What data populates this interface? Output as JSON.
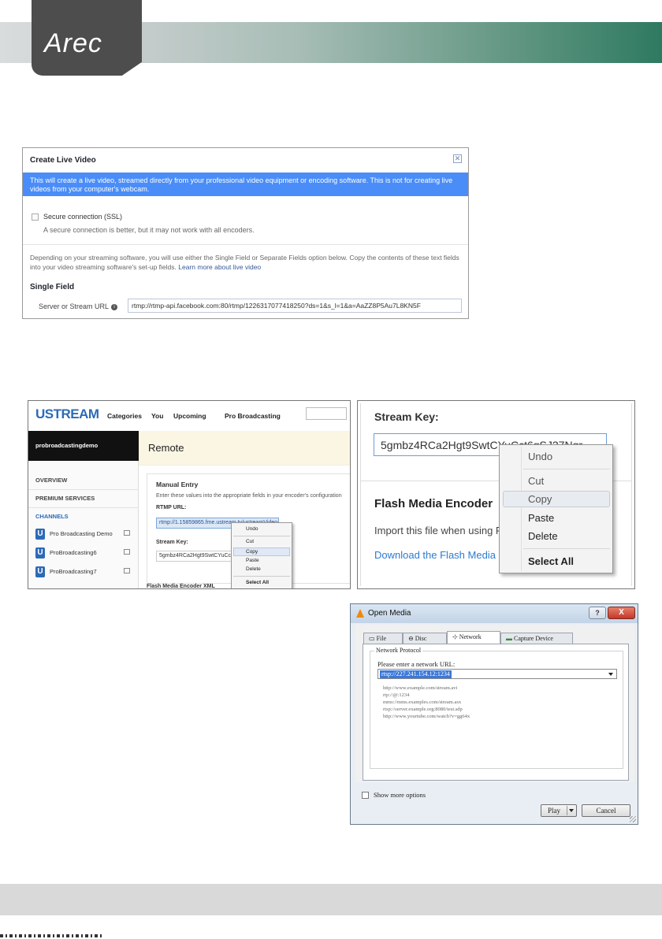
{
  "brand": {
    "logo_text": "Arec"
  },
  "facebook_dialog": {
    "title": "Create Live Video",
    "close_glyph": "✕",
    "banner": "This will create a live video, streamed directly from your professional video equipment or encoding software. This is not for creating live videos from your computer's webcam.",
    "ssl_label": "Secure connection (SSL)",
    "ssl_note": "A secure connection is better, but it may not work with all encoders.",
    "description": "Depending on your streaming software, you will use either the Single Field or Separate Fields option below. Copy the contents of these text fields into your video streaming software's set-up fields.",
    "learn_more": "Learn more about live video",
    "single_field_heading": "Single Field",
    "url_label": "Server or Stream URL",
    "info_glyph": "i",
    "url_value": "rtmp://rtmp-api.facebook.com:80/rtmp/1226317077418250?ds=1&s_l=1&a=AaZZ8P5Au7L8KN5F"
  },
  "ustream": {
    "logo": "USTREAM",
    "nav": [
      "Categories",
      "You",
      "Upcoming",
      "Pro Broadcasting"
    ],
    "username": "probroadcastingdemo",
    "menu": {
      "overview": "OVERVIEW",
      "premium": "PREMIUM SERVICES",
      "channels": "CHANNELS"
    },
    "channels": [
      "Pro Broadcasting Demo",
      "ProBroadcasting6",
      "ProBroadcasting7"
    ],
    "channel_glyph": "U",
    "page_title": "Remote",
    "manual_entry": "Manual Entry",
    "manual_hint": "Enter these values into the appropriate fields in your encoder's configuration",
    "rtmp_label": "RTMP URL:",
    "rtmp_value": "rtmp://1.15859865.fme.ustream.tv/ustreamVideo/15859865",
    "stream_key_label": "Stream Key:",
    "stream_key_value": "5gmbz4RCa2Hgt9SwtCYuCct6gSJ27Ngr",
    "bottom_text": "Flash Media Encoder XML",
    "context_menu": [
      "Undo",
      "Cut",
      "Copy",
      "Paste",
      "Delete",
      "Select All"
    ]
  },
  "stream_key_zoom": {
    "title": "Stream Key:",
    "value": "5gmbz4RCa2Hgt9SwtCYuCct6gSJ27Ngr",
    "fme_heading": "Flash Media Encoder",
    "import_text": "Import this file when using Flash Media Encoder",
    "download_link": "Download the Flash Media Encoder settings file",
    "context_menu": {
      "undo": "Undo",
      "cut": "Cut",
      "copy": "Copy",
      "paste": "Paste",
      "delete": "Delete",
      "select_all": "Select All"
    }
  },
  "vlc": {
    "title": "Open Media",
    "help_glyph": "?",
    "close_glyph": "X",
    "tabs": [
      "File",
      "Disc",
      "Network",
      "Capture Device"
    ],
    "active_tab": "Network",
    "group_label": "Network Protocol",
    "prompt": "Please enter a network URL:",
    "url_value": "rtsp://227.241.154.12:1234",
    "examples": [
      "http://www.example.com/stream.avi",
      "rtp://@:1234",
      "mms://mms.examples.com/stream.asx",
      "rtsp://server.example.org:8080/test.sdp",
      "http://www.yourtube.com/watch?v=gg64x"
    ],
    "show_more": "Show more options",
    "play": "Play",
    "cancel": "Cancel"
  }
}
